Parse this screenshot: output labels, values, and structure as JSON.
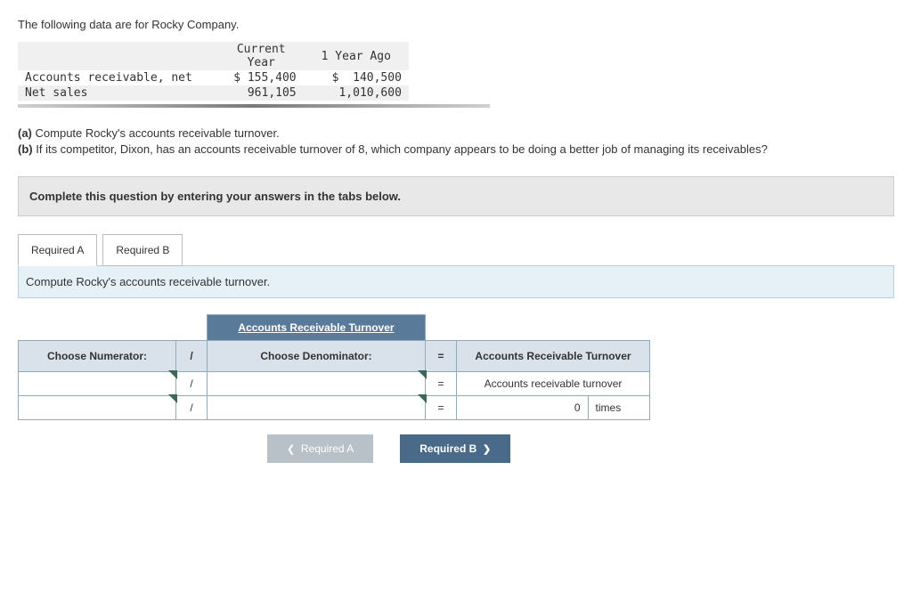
{
  "intro": "The following data are for Rocky Company.",
  "data_table": {
    "col1_header": "Current\nYear",
    "col2_header": "1 Year Ago",
    "rows": [
      {
        "label": "Accounts receivable, net",
        "c1": "$ 155,400",
        "c2": "$  140,500"
      },
      {
        "label": "Net sales",
        "c1": "961,105",
        "c2": "1,010,600"
      }
    ]
  },
  "questions": {
    "a_label": "(a)",
    "a_text": "Compute Rocky's accounts receivable turnover.",
    "b_label": "(b)",
    "b_text": "If its competitor, Dixon, has an accounts receivable turnover of 8, which company appears to be doing a better job of managing its receivables?"
  },
  "instruction": "Complete this question by entering your answers in the tabs below.",
  "tabs": {
    "a": "Required A",
    "b": "Required B"
  },
  "sub_instruction": "Compute Rocky's accounts receivable turnover.",
  "answer_area": {
    "title": "Accounts Receivable Turnover",
    "numerator": "Choose Numerator:",
    "slash": "/",
    "denominator": "Choose Denominator:",
    "eq": "=",
    "result_header": "Accounts Receivable Turnover",
    "result_label": "Accounts receivable turnover",
    "value": "0",
    "units": "times"
  },
  "nav": {
    "prev": "Required A",
    "next": "Required B"
  }
}
